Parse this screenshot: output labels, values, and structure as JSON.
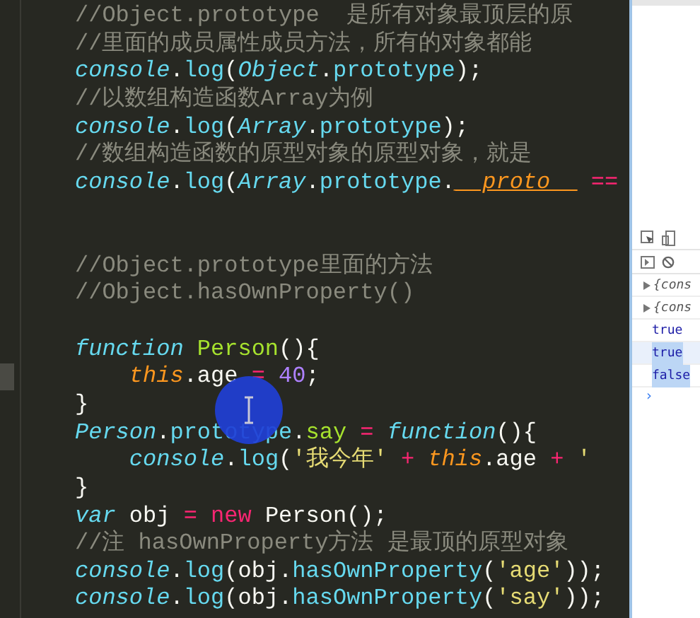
{
  "editor": {
    "lines": [
      {
        "kind": "code",
        "current": false,
        "tokens": [
          {
            "kind": "comment",
            "text": "//Object.prototype  是所有对象最顶层的原"
          }
        ]
      },
      {
        "kind": "code",
        "current": false,
        "tokens": [
          {
            "kind": "comment",
            "text": "//里面的成员属性成员方法，所有的对象都能"
          }
        ]
      },
      {
        "kind": "code",
        "current": false,
        "tokens": [
          {
            "kind": "object",
            "text": "console"
          },
          {
            "kind": "plain",
            "text": "."
          },
          {
            "kind": "member",
            "text": "log"
          },
          {
            "kind": "plain",
            "text": "("
          },
          {
            "kind": "object",
            "text": "Object"
          },
          {
            "kind": "plain",
            "text": "."
          },
          {
            "kind": "member",
            "text": "prototype"
          },
          {
            "kind": "plain",
            "text": ");"
          }
        ]
      },
      {
        "kind": "code",
        "current": false,
        "tokens": [
          {
            "kind": "comment",
            "text": "//以数组构造函数Array为例"
          }
        ]
      },
      {
        "kind": "code",
        "current": false,
        "tokens": [
          {
            "kind": "object",
            "text": "console"
          },
          {
            "kind": "plain",
            "text": "."
          },
          {
            "kind": "member",
            "text": "log"
          },
          {
            "kind": "plain",
            "text": "("
          },
          {
            "kind": "object",
            "text": "Array"
          },
          {
            "kind": "plain",
            "text": "."
          },
          {
            "kind": "member",
            "text": "prototype"
          },
          {
            "kind": "plain",
            "text": ");"
          }
        ]
      },
      {
        "kind": "code",
        "current": false,
        "tokens": [
          {
            "kind": "comment",
            "text": "//数组构造函数的原型对象的原型对象，就是"
          }
        ]
      },
      {
        "kind": "code",
        "current": false,
        "tokens": [
          {
            "kind": "object",
            "text": "console"
          },
          {
            "kind": "plain",
            "text": "."
          },
          {
            "kind": "member",
            "text": "log"
          },
          {
            "kind": "plain",
            "text": "("
          },
          {
            "kind": "object",
            "text": "Array"
          },
          {
            "kind": "plain",
            "text": "."
          },
          {
            "kind": "member",
            "text": "prototype"
          },
          {
            "kind": "plain",
            "text": "."
          },
          {
            "kind": "proto",
            "text": "__proto__"
          },
          {
            "kind": "operator",
            "text": " =="
          }
        ]
      },
      {
        "kind": "blank",
        "current": false
      },
      {
        "kind": "blank",
        "current": false
      },
      {
        "kind": "code",
        "current": false,
        "tokens": [
          {
            "kind": "comment",
            "text": "//Object.prototype里面的方法"
          }
        ]
      },
      {
        "kind": "code",
        "current": false,
        "tokens": [
          {
            "kind": "comment",
            "text": "//Object.hasOwnProperty()"
          }
        ]
      },
      {
        "kind": "blank",
        "current": false
      },
      {
        "kind": "code",
        "current": false,
        "tokens": [
          {
            "kind": "keyword",
            "text": "function"
          },
          {
            "kind": "function",
            "text": " Person"
          },
          {
            "kind": "plain",
            "text": "(){"
          }
        ]
      },
      {
        "kind": "code",
        "current": true,
        "tokens": [
          {
            "kind": "this",
            "text": "    this"
          },
          {
            "kind": "plain",
            "text": ".age "
          },
          {
            "kind": "operator",
            "text": "="
          },
          {
            "kind": "number",
            "text": " 40"
          },
          {
            "kind": "plain",
            "text": ";"
          }
        ]
      },
      {
        "kind": "code",
        "current": false,
        "tokens": [
          {
            "kind": "plain",
            "text": "}"
          }
        ]
      },
      {
        "kind": "code",
        "current": false,
        "tokens": [
          {
            "kind": "object",
            "text": "Person"
          },
          {
            "kind": "plain",
            "text": "."
          },
          {
            "kind": "member",
            "text": "prototype"
          },
          {
            "kind": "plain",
            "text": "."
          },
          {
            "kind": "function",
            "text": "say"
          },
          {
            "kind": "operator",
            "text": " = "
          },
          {
            "kind": "keyword",
            "text": "function"
          },
          {
            "kind": "plain",
            "text": "(){"
          }
        ]
      },
      {
        "kind": "code",
        "current": false,
        "tokens": [
          {
            "kind": "object",
            "text": "    console"
          },
          {
            "kind": "plain",
            "text": "."
          },
          {
            "kind": "member",
            "text": "log"
          },
          {
            "kind": "plain",
            "text": "("
          },
          {
            "kind": "string",
            "text": "'我今年'"
          },
          {
            "kind": "operator",
            "text": " + "
          },
          {
            "kind": "this",
            "text": "this"
          },
          {
            "kind": "plain",
            "text": ".age "
          },
          {
            "kind": "operator",
            "text": "+"
          },
          {
            "kind": "string",
            "text": " '"
          }
        ]
      },
      {
        "kind": "code",
        "current": false,
        "tokens": [
          {
            "kind": "plain",
            "text": "}"
          }
        ]
      },
      {
        "kind": "code",
        "current": false,
        "tokens": [
          {
            "kind": "keyword",
            "text": "var"
          },
          {
            "kind": "plain",
            "text": " obj "
          },
          {
            "kind": "operator",
            "text": "= new"
          },
          {
            "kind": "plain",
            "text": " Person();"
          }
        ]
      },
      {
        "kind": "code",
        "current": false,
        "tokens": [
          {
            "kind": "comment",
            "text": "//注 hasOwnProperty方法 是最顶的原型对象"
          }
        ]
      },
      {
        "kind": "code",
        "current": false,
        "tokens": [
          {
            "kind": "object",
            "text": "console"
          },
          {
            "kind": "plain",
            "text": "."
          },
          {
            "kind": "member",
            "text": "log"
          },
          {
            "kind": "plain",
            "text": "(obj."
          },
          {
            "kind": "member",
            "text": "hasOwnProperty"
          },
          {
            "kind": "plain",
            "text": "("
          },
          {
            "kind": "string",
            "text": "'age'"
          },
          {
            "kind": "plain",
            "text": "));"
          }
        ]
      },
      {
        "kind": "code",
        "current": false,
        "tokens": [
          {
            "kind": "object",
            "text": "console"
          },
          {
            "kind": "plain",
            "text": "."
          },
          {
            "kind": "member",
            "text": "log"
          },
          {
            "kind": "plain",
            "text": "(obj."
          },
          {
            "kind": "member",
            "text": "hasOwnProperty"
          },
          {
            "kind": "plain",
            "text": "("
          },
          {
            "kind": "string",
            "text": "'say'"
          },
          {
            "kind": "plain",
            "text": "));"
          }
        ]
      }
    ]
  },
  "console": {
    "entries": [
      {
        "kind": "object",
        "text": "{cons",
        "selected": false
      },
      {
        "kind": "object",
        "text": "{cons",
        "selected": false
      },
      {
        "kind": "value",
        "text": "true",
        "selected": false
      },
      {
        "kind": "value",
        "text": "true",
        "selected": true
      },
      {
        "kind": "value",
        "text": "false",
        "selected": false
      }
    ],
    "prompt": "›"
  }
}
